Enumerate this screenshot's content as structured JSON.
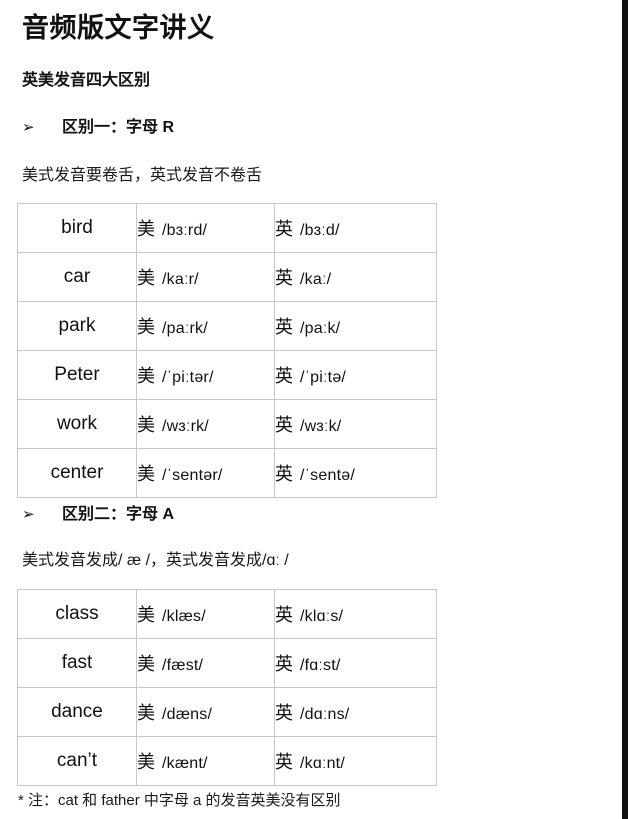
{
  "document": {
    "title": "音频版文字讲义",
    "section_heading": "英美发音四大区别",
    "footnote": "* 注：cat 和 father 中字母 a 的发音英美没有区别",
    "bullet_marker": "➢",
    "lang_us": "美",
    "lang_uk": "英"
  },
  "sections": [
    {
      "bullet_label": "区别一：字母 R",
      "rule": "美式发音要卷舌，英式发音不卷舌",
      "rows": [
        {
          "word": "bird",
          "us": "/bɜːrd/",
          "uk": "/bɜːd/"
        },
        {
          "word": "car",
          "us": "/kaːr/",
          "uk": "/kaː/"
        },
        {
          "word": "park",
          "us": "/paːrk/",
          "uk": "/paːk/"
        },
        {
          "word": "Peter",
          "us": "/ˈpiːtər/",
          "uk": "/ˈpiːtə/"
        },
        {
          "word": "work",
          "us": "/wɜːrk/",
          "uk": "/wɜːk/"
        },
        {
          "word": "center",
          "us": "/ˈsentər/",
          "uk": "/ˈsentə/"
        }
      ]
    },
    {
      "bullet_label": "区别二：字母 A",
      "rule": "美式发音发成/ æ /，英式发音发成/ɑː /",
      "rows": [
        {
          "word": "class",
          "us": "/klæs/",
          "uk": "/klɑːs/"
        },
        {
          "word": "fast",
          "us": "/fæst/",
          "uk": "/fɑːst/"
        },
        {
          "word": "dance",
          "us": "/dæns/",
          "uk": "/dɑːns/"
        },
        {
          "word": "can’t",
          "us": "/kænt/",
          "uk": "/kɑːnt/"
        }
      ]
    }
  ],
  "colors": {
    "page_background": "#ffffff",
    "text": "#1a1a1a",
    "table_border": "#c8c8c8",
    "right_edge": "#111111"
  }
}
